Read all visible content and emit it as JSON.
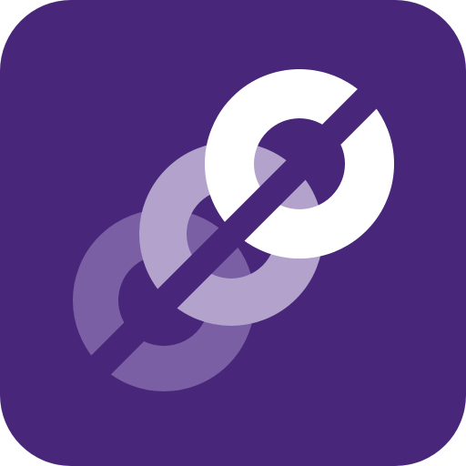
{
  "icon": {
    "name": "chained-rings-app-icon",
    "colors": {
      "background": "#48267A",
      "ring_back": "#7B5FA4",
      "ring_middle": "#B3A3CC",
      "ring_front": "#FFFFFF"
    }
  }
}
